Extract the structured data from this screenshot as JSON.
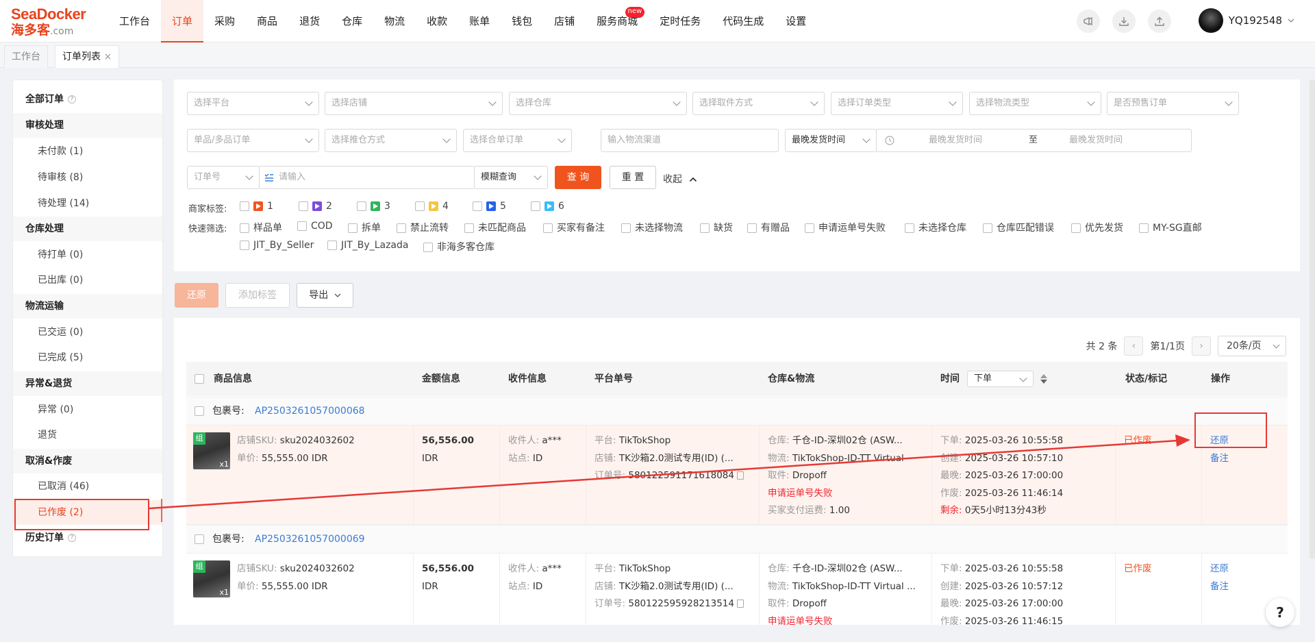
{
  "brand": {
    "line1": "SeaDocker",
    "line2": "海多客",
    "suffix": ".com"
  },
  "menu": [
    {
      "label": "工作台"
    },
    {
      "label": "订单",
      "active": true
    },
    {
      "label": "采购"
    },
    {
      "label": "商品"
    },
    {
      "label": "退货"
    },
    {
      "label": "仓库"
    },
    {
      "label": "物流"
    },
    {
      "label": "收款"
    },
    {
      "label": "账单"
    },
    {
      "label": "钱包"
    },
    {
      "label": "店铺"
    },
    {
      "label": "服务商城",
      "badge": "new"
    },
    {
      "label": "定时任务"
    },
    {
      "label": "代码生成"
    },
    {
      "label": "设置"
    }
  ],
  "header_icons": [
    "megaphone-icon",
    "download-icon",
    "upload-icon"
  ],
  "user": {
    "name": "YQ192548"
  },
  "tabs": [
    {
      "label": "工作台"
    },
    {
      "label": "订单列表",
      "close": "×"
    }
  ],
  "sidebar": {
    "all_orders": "全部订单",
    "sections": [
      {
        "title": "审核处理",
        "items": [
          "未付款 (1)",
          "待审核 (8)",
          "待处理 (14)"
        ]
      },
      {
        "title": "仓库处理",
        "items": [
          "待打单 (0)",
          "已出库 (0)"
        ]
      },
      {
        "title": "物流运输",
        "items": [
          "已交运 (0)",
          "已完成 (5)"
        ]
      },
      {
        "title": "异常&退货",
        "items": [
          "异常 (0)",
          "退货"
        ]
      },
      {
        "title": "取消&作废",
        "items": [
          "已取消 (46)",
          "已作废 (2)"
        ]
      }
    ],
    "history": "历史订单",
    "active_item": "已作废 (2)"
  },
  "filters": {
    "row1": [
      "选择平台",
      "选择店铺",
      "选择仓库",
      "选择取件方式",
      "选择订单类型",
      "选择物流类型",
      "是否预售订单"
    ],
    "row2": [
      "单品/多品订单",
      "选择推仓方式",
      "选择合单订单"
    ],
    "logistics_channel_placeholder": "输入物流渠道",
    "ship_time_select": "最晚发货时间",
    "date_start_placeholder": "最晚发货时间",
    "date_sep": "至",
    "date_end_placeholder": "最晚发货时间",
    "order_no_select": "订单号",
    "search_placeholder": "请输入",
    "match_mode": "模糊查询",
    "query_button": "查 询",
    "reset_button": "重 置",
    "collapse": "收起",
    "merchant_tags_label": "商家标签:",
    "merchant_tags": [
      {
        "label": "1",
        "color": "#f0541e"
      },
      {
        "label": "2",
        "color": "#7b4ddb"
      },
      {
        "label": "3",
        "color": "#2fb55d"
      },
      {
        "label": "4",
        "color": "#f5c542"
      },
      {
        "label": "5",
        "color": "#2563eb"
      },
      {
        "label": "6",
        "color": "#38bdf8"
      }
    ],
    "quick_filter_label": "快速筛选:",
    "quick_filters_row1": [
      "样品单",
      "COD",
      "拆单",
      "禁止流转",
      "未匹配商品",
      "买家有备注",
      "未选择物流",
      "缺货",
      "有赠品",
      "申请运单号失败",
      "未选择仓库",
      "仓库匹配错误",
      "优先发货",
      "MY-SG直邮"
    ],
    "quick_filters_row2": [
      "JIT_By_Seller",
      "JIT_By_Lazada",
      "非海多客仓库"
    ]
  },
  "actions": {
    "restore": "还原",
    "add_tag": "添加标签",
    "export": "导出"
  },
  "pagination": {
    "total": "共 2 条",
    "page": "第1/1页",
    "page_size": "20条/页"
  },
  "table": {
    "headers": [
      "商品信息",
      "金额信息",
      "收件信息",
      "平台单号",
      "仓库&物流",
      "时间",
      "状态/标记",
      "操作"
    ],
    "time_sort_select": "下单",
    "package_label": "包裹号:",
    "orders": [
      {
        "package_no": "AP2503261057000068",
        "tag": "组",
        "qty": "x1",
        "sku_label": "店铺SKU:",
        "sku": "sku2024032602",
        "price_label": "单价:",
        "price": "55,555.00 IDR",
        "amount": "56,556.00",
        "currency": "IDR",
        "receiver_label": "收件人:",
        "receiver": "a***",
        "site_label": "站点:",
        "site": "ID",
        "platform_label": "平台:",
        "platform": "TikTokShop",
        "store_label": "店铺:",
        "store": "TK沙箱2.0测试专用(ID) (...",
        "orderno_label": "订单号:",
        "order_no": "580122591171618084",
        "warehouse_label": "仓库:",
        "warehouse": "千仓-ID-深圳02仓 (ASW...",
        "logistics_label": "物流:",
        "logistics": "TikTokShop-ID-TT Virtual",
        "pickup_label": "取件:",
        "pickup": "Dropoff",
        "error": "申请运单号失败",
        "shipping_fee_label": "买家支付运费:",
        "shipping_fee": "1.00",
        "t_order_label": "下单:",
        "t_order": "2025-03-26 10:55:58",
        "t_create_label": "创建:",
        "t_create": "2025-03-26 10:57:10",
        "t_latest_label": "最晚:",
        "t_latest": "2025-03-26 17:00:00",
        "t_void_label": "作废:",
        "t_void": "2025-03-26 11:46:14",
        "remaining_label": "剩余:",
        "remaining": "0天5小时13分43秒",
        "status": "已作废",
        "op_restore": "还原",
        "op_note": "备注"
      },
      {
        "package_no": "AP2503261057000069",
        "tag": "组",
        "qty": "x1",
        "sku_label": "店铺SKU:",
        "sku": "sku2024032602",
        "price_label": "单价:",
        "price": "55,555.00 IDR",
        "amount": "56,556.00",
        "currency": "IDR",
        "receiver_label": "收件人:",
        "receiver": "a***",
        "site_label": "站点:",
        "site": "ID",
        "platform_label": "平台:",
        "platform": "TikTokShop",
        "store_label": "店铺:",
        "store": "TK沙箱2.0测试专用(ID) (...",
        "orderno_label": "订单号:",
        "order_no": "580122595928213514",
        "warehouse_label": "仓库:",
        "warehouse": "千仓-ID-深圳02仓 (ASW...",
        "logistics_label": "物流:",
        "logistics": "TikTokShop-ID-TT Virtual ...",
        "pickup_label": "取件:",
        "pickup": "Dropoff",
        "error": "申请运单号失败",
        "t_order_label": "下单:",
        "t_order": "2025-03-26 10:55:58",
        "t_create_label": "创建:",
        "t_create": "2025-03-26 10:57:12",
        "t_latest_label": "最晚:",
        "t_latest": "2025-03-26 17:00:00",
        "t_void_label": "作废:",
        "t_void": "2025-03-26 11:46:15",
        "status": "已作废",
        "op_restore": "还原",
        "op_note": "备注"
      }
    ]
  },
  "help": "?",
  "colors": {
    "accent": "#f0541e",
    "link": "#3a7bd5",
    "error": "#f5222d",
    "annotation": "#e53935"
  }
}
